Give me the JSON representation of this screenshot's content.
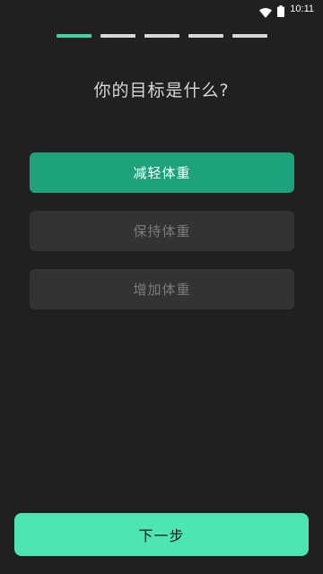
{
  "status_bar": {
    "time": "10:11",
    "icons": [
      "wifi-icon",
      "battery-icon"
    ]
  },
  "progress": {
    "total_steps": 5,
    "current_step": 1
  },
  "question": {
    "title": "你的目标是什么?"
  },
  "options": [
    {
      "label": "减轻体重",
      "selected": true
    },
    {
      "label": "保持体重",
      "selected": false
    },
    {
      "label": "增加体重",
      "selected": false
    }
  ],
  "footer": {
    "next_label": "下一步"
  },
  "colors": {
    "background": "#202020",
    "accent_active": "#3fd6a3",
    "option_selected": "#1ea27b",
    "option_unselected": "#333333",
    "next_button": "#4de6b2"
  }
}
